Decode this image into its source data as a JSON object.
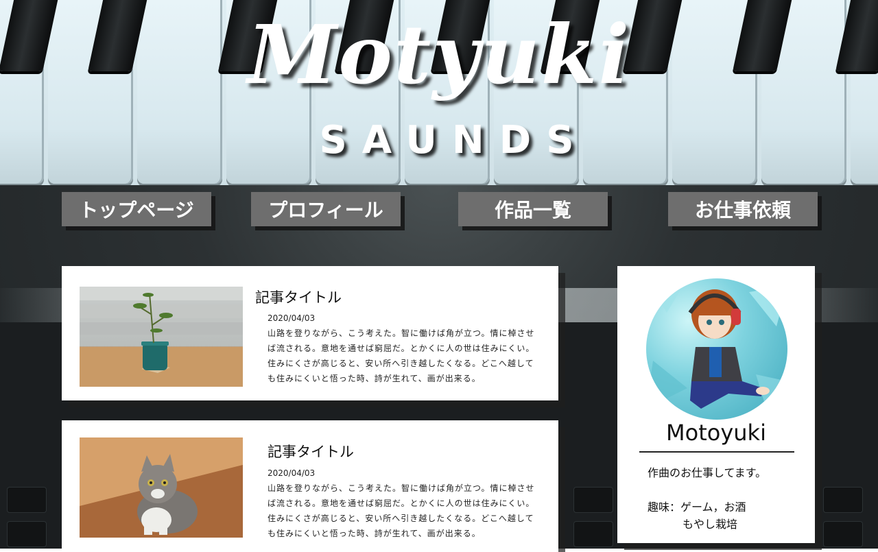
{
  "logo": {
    "main": "Motyuki",
    "sub": "SAUNDS"
  },
  "nav": [
    {
      "label": "トップページ"
    },
    {
      "label": "プロフィール"
    },
    {
      "label": "作品一覧"
    },
    {
      "label": "お仕事依頼"
    }
  ],
  "articles": [
    {
      "title": "記事タイトル",
      "date": "2020/04/03",
      "body": "山路を登りながら、こう考えた。智に働けば角が立つ。情に棹させば流される。意地を通せば窮屈だ。とかくに人の世は住みにくい。住みにくさが高じると、安い所へ引き越したくなる。どこへ越しても住みにくいと悟った時、詩が生れて、画が出来る。",
      "image": "potted-plant-photo"
    },
    {
      "title": "記事タイトル",
      "date": "2020/04/03",
      "body": "山路を登りながら、こう考えた。智に働けば角が立つ。情に棹させば流される。意地を通せば窮屈だ。とかくに人の世は住みにくい。住みにくさが高じると、安い所へ引き越したくなる。どこへ越しても住みにくいと悟った時、詩が生れて、画が出来る。",
      "image": "cat-photo"
    }
  ],
  "profile": {
    "name": "Motoyuki",
    "description": "作曲のお仕事してます。",
    "hobby_line1": "趣味：ゲーム，お酒",
    "hobby_line2": "もやし栽培",
    "avatar": "anime-avatar-with-headphones"
  },
  "colors": {
    "nav_bg": "#6e6e6e",
    "card_bg": "#ffffff",
    "text": "#111111"
  }
}
